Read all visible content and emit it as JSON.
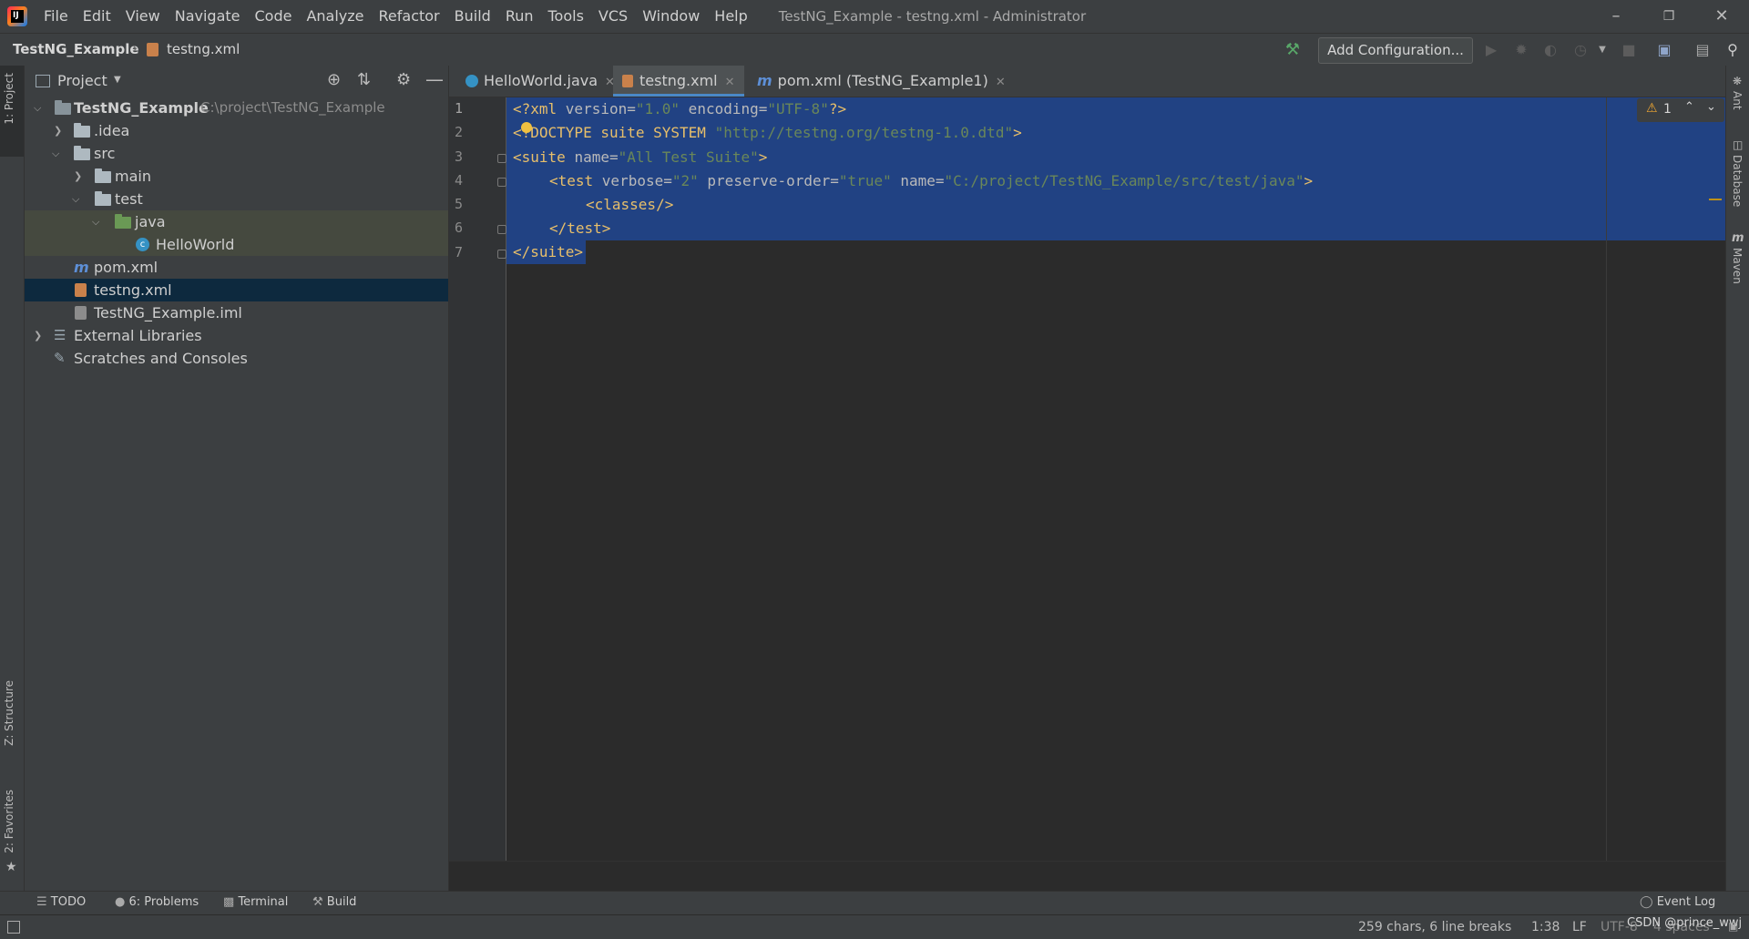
{
  "menubar": {
    "items": [
      "File",
      "Edit",
      "View",
      "Navigate",
      "Code",
      "Analyze",
      "Refactor",
      "Build",
      "Run",
      "Tools",
      "VCS",
      "Window",
      "Help"
    ],
    "window_title": "TestNG_Example - testng.xml - Administrator"
  },
  "navbar": {
    "project": "TestNG_Example",
    "file": "testng.xml",
    "add_configuration": "Add Configuration..."
  },
  "left_strip": {
    "project": "1: Project",
    "structure": "Z: Structure",
    "favorites": "2: Favorites"
  },
  "right_strip": {
    "ant": "Ant",
    "database": "Database",
    "maven": "Maven"
  },
  "project_panel": {
    "title": "Project",
    "tree": {
      "root": "TestNG_Example",
      "root_path": "C:\\project\\TestNG_Example",
      "idea": ".idea",
      "src": "src",
      "main": "main",
      "test": "test",
      "java": "java",
      "helloworld": "HelloWorld",
      "pom": "pom.xml",
      "testng": "testng.xml",
      "iml": "TestNG_Example.iml",
      "external": "External Libraries",
      "scratches": "Scratches and Consoles"
    }
  },
  "tabs": {
    "helloworld": "HelloWorld.java",
    "testng": "testng.xml",
    "pom": "pom.xml (TestNG_Example1)"
  },
  "editor": {
    "line_numbers": [
      "1",
      "2",
      "3",
      "4",
      "5",
      "6",
      "7"
    ],
    "warning_count": "1",
    "code": {
      "l1_a": "<?xml ",
      "l1_attr1": "version",
      "l1_eq1": "=",
      "l1_v1": "\"1.0\"",
      "l1_attr2": " encoding",
      "l1_eq2": "=",
      "l1_v2": "\"UTF-8\"",
      "l1_end": "?>",
      "l2_a": "<!DOCTYPE suite SYSTEM ",
      "l2_v": "\"http://testng.org/testng-1.0.dtd\"",
      "l2_end": ">",
      "l3_a": "<suite ",
      "l3_attr": "name",
      "l3_eq": "=",
      "l3_v": "\"All Test Suite\"",
      "l3_end": ">",
      "l4_a": "<test ",
      "l4_attr1": "verbose",
      "l4_eq1": "=",
      "l4_v1": "\"2\"",
      "l4_attr2": " preserve-order",
      "l4_eq2": "=",
      "l4_v2": "\"true\"",
      "l4_attr3": " name",
      "l4_eq3": "=",
      "l4_v3": "\"C:/project/TestNG_Example/src/test/java\"",
      "l4_end": ">",
      "l5": "<classes/>",
      "l6": "</test>",
      "l7": "</suite>"
    }
  },
  "toolwindows": {
    "todo": "TODO",
    "problems": "6: Problems",
    "terminal": "Terminal",
    "build": "Build",
    "event_log": "Event Log"
  },
  "status": {
    "chars": "259 chars, 6 line breaks",
    "position": "1:38",
    "line_sep": "LF",
    "encoding": "UTF-8",
    "indent": "4 spaces",
    "watermark": "CSDN @prince_wwj"
  }
}
